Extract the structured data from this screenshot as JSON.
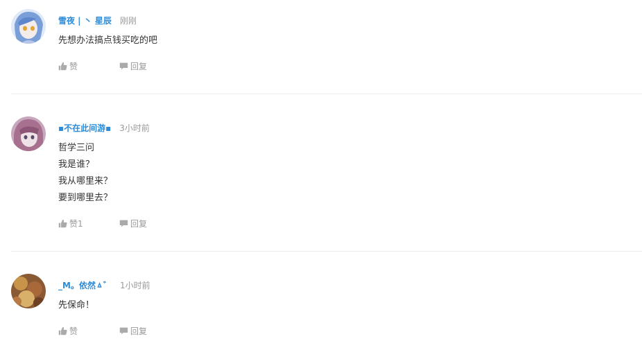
{
  "comments": [
    {
      "username": "雪夜 | 丶 星辰",
      "time": "刚刚",
      "lines": [
        "先想办法搞点钱买吃的吧"
      ],
      "like_label": "赞",
      "reply_label": "回复"
    },
    {
      "username": "▪不在此间游▪",
      "time": "3小时前",
      "lines": [
        "哲学三问",
        "我是谁？",
        "我从哪里来？",
        "要到哪里去？"
      ],
      "like_label": "赞1",
      "reply_label": "回复"
    },
    {
      "username": "_M。依然ㅿ゛",
      "time": "1小时前",
      "lines": [
        "先保命！"
      ],
      "like_label": "赞",
      "reply_label": "回复"
    }
  ],
  "colors": {
    "username": "#2d8bd8",
    "meta": "#999999",
    "text": "#333333",
    "divider": "#ececec"
  },
  "icons": {
    "like": "thumbs-up-icon",
    "reply": "speech-bubble-icon"
  }
}
